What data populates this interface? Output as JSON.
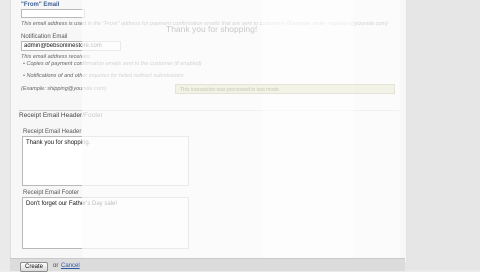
{
  "form": {
    "from_email_label": "\"From\" Email",
    "from_email_value": "",
    "from_email_help": "This email address is used in the \"From\" address for payment confirmation emails that are sent to customers (Example: order_inquiries@yoursite.com)",
    "notification_email_label": "Notification Email",
    "notification_email_value": "admin@bebsonlinestore.com",
    "notification_help_intro": "This email address receives:",
    "notification_bullets": [
      "Copies of payment confirmation emails sent to the customer (if enabled)",
      "Notifications of and other inquiries for failed redirect submissions"
    ],
    "notification_example": "(Example: shipping@yoursite.com)",
    "receipt_section_title": "Receipt Email Header/Footer",
    "receipt_header_label": "Receipt Email Header",
    "receipt_header_value": "Thank you for shopping.",
    "receipt_footer_label": "Receipt Email Footer",
    "receipt_footer_value": "Don't forget our Father's Day sale!"
  },
  "preview": {
    "title": "Thank you for shopping!",
    "notice": "This transaction was processed in test mode."
  },
  "actions": {
    "create_label": "Create",
    "or_label": "or",
    "cancel_label": "Cancel"
  }
}
